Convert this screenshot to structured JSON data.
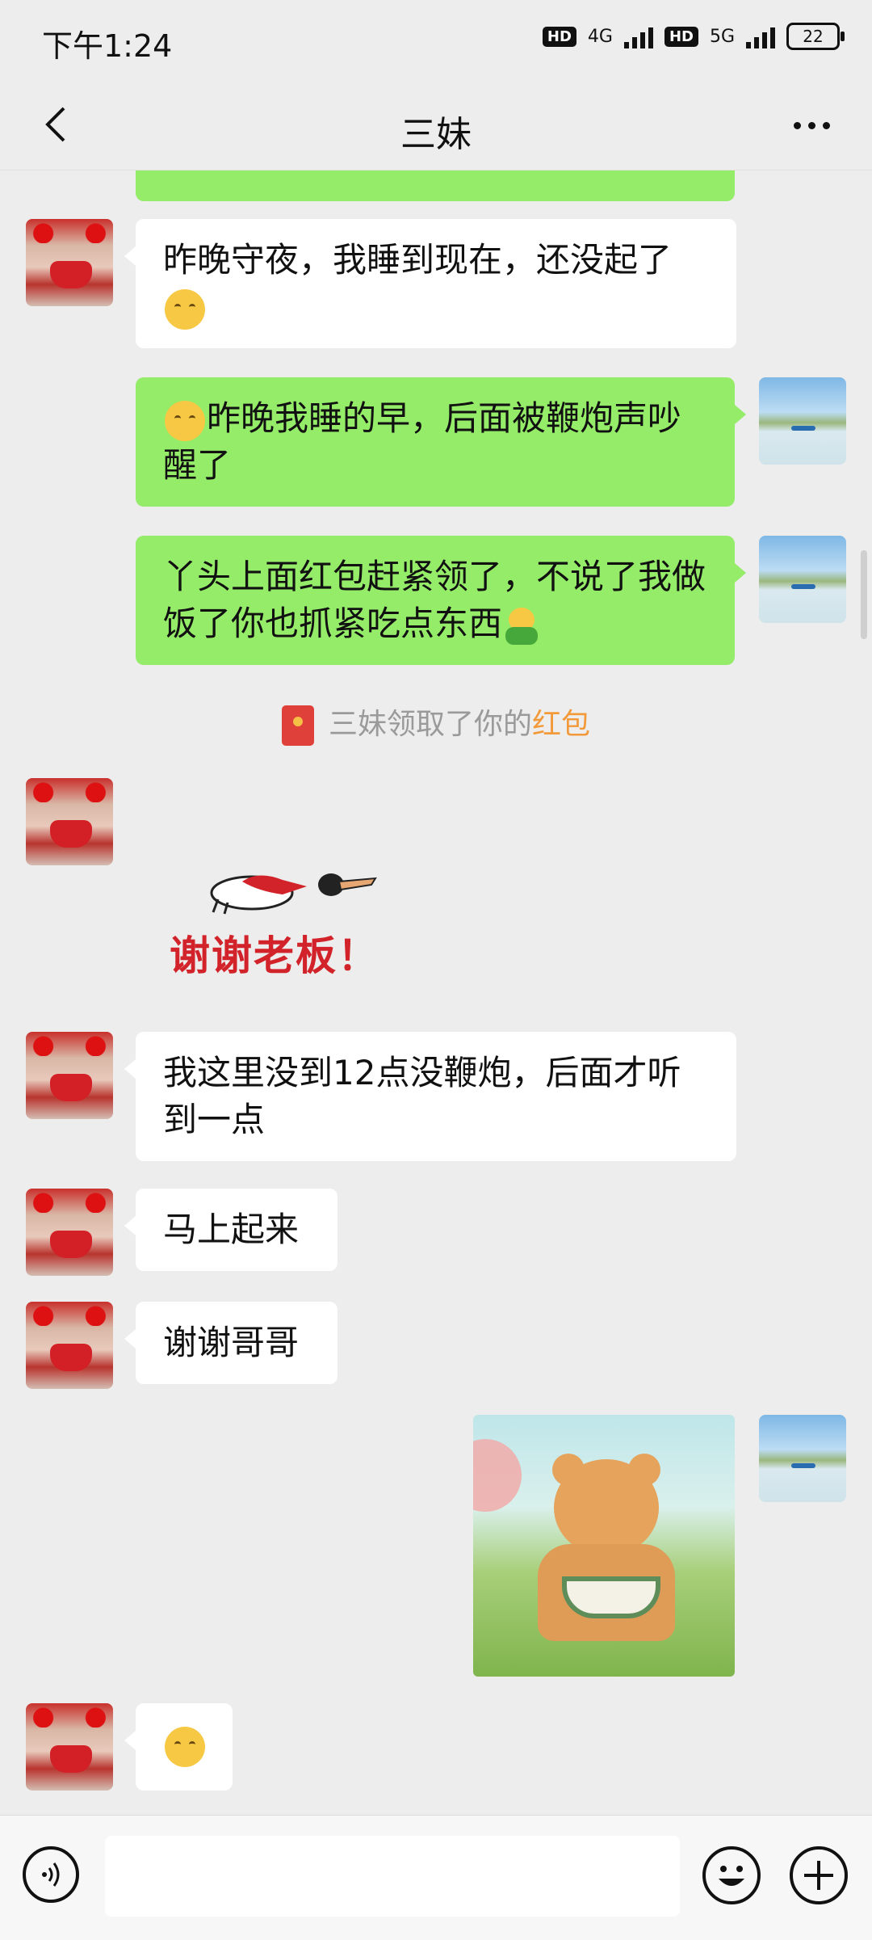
{
  "status_bar": {
    "time": "下午1:24",
    "hd1": "HD",
    "net1": "4G",
    "hd2": "HD",
    "net2": "5G",
    "battery": "22"
  },
  "nav": {
    "title": "三妹",
    "back_icon": "chevron-left-icon",
    "more_icon": "more-horizontal-icon"
  },
  "messages": [
    {
      "from": "them",
      "text": "昨晚守夜，我睡到现在，还没起了",
      "emoji": "thinking-face"
    },
    {
      "from": "me",
      "emoji": "sweat-face",
      "text": "昨晚我睡的早，后面被鞭炮声吵醒了"
    },
    {
      "from": "me",
      "text": "丫头上面红包赶紧领了，不说了我做饭了你也抓紧吃点东西",
      "emoji": "hugging-face"
    },
    {
      "type": "system",
      "prefix": "三妹领取了你的",
      "link": "红包"
    },
    {
      "from": "them",
      "type": "sticker",
      "caption": "谢谢老板！"
    },
    {
      "from": "them",
      "text": "我这里没到12点没鞭炮，后面才听到一点"
    },
    {
      "from": "them",
      "text": "马上起来"
    },
    {
      "from": "them",
      "text": "谢谢哥哥"
    },
    {
      "from": "me",
      "type": "image",
      "desc": "bear-sticker-image"
    },
    {
      "from": "them",
      "type": "emoji",
      "emoji": "shy-face"
    }
  ],
  "input_bar": {
    "voice_icon": "voice-icon",
    "emoji_icon": "emoji-icon",
    "plus_icon": "plus-icon"
  },
  "colors": {
    "background": "#EDEDED",
    "outgoing_bubble": "#95EC69",
    "incoming_bubble": "#FFFFFF",
    "link": "#F29A3A",
    "red_packet": "#E0403A"
  }
}
